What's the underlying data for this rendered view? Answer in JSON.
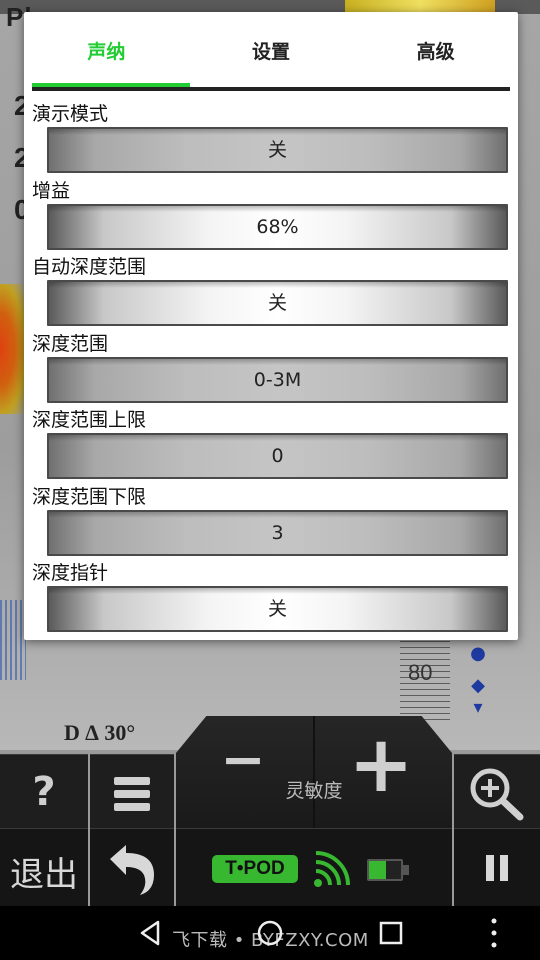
{
  "background": {
    "logo_text": "Pl",
    "readout_lines": [
      "2",
      "2",
      "0"
    ],
    "depth_marker": "80",
    "scale_label": "D ∆ 30°"
  },
  "dialog": {
    "tabs": [
      {
        "label": "声纳",
        "active": true
      },
      {
        "label": "设置",
        "active": false
      },
      {
        "label": "高级",
        "active": false
      }
    ],
    "settings": [
      {
        "label": "演示模式",
        "value": "关"
      },
      {
        "label": "增益",
        "value": "68%"
      },
      {
        "label": "自动深度范围",
        "value": "关"
      },
      {
        "label": "深度范围",
        "value": "0-3M"
      },
      {
        "label": "深度范围上限",
        "value": "0"
      },
      {
        "label": "深度范围下限",
        "value": "3"
      },
      {
        "label": "深度指针",
        "value": "关"
      }
    ]
  },
  "controls": {
    "help_glyph": "?",
    "menu_icon": "menu-icon",
    "sensitivity_label": "灵敏度",
    "minus_glyph": "−",
    "plus_glyph": "+",
    "zoom_icon": "zoom-in-icon",
    "exit_label": "退出",
    "back_icon": "undo-arrow-icon",
    "device_badge": "T•POD",
    "signal_icon": "wifi-signal-icon",
    "battery_icon": "battery-icon",
    "pause_icon": "pause-icon"
  },
  "navbar": {
    "watermark": "飞下载 • BYFZXY.COM"
  },
  "colors": {
    "accent_green": "#22cc33",
    "badge_green": "#38b830",
    "panel_dark": "#1e1e1e"
  }
}
